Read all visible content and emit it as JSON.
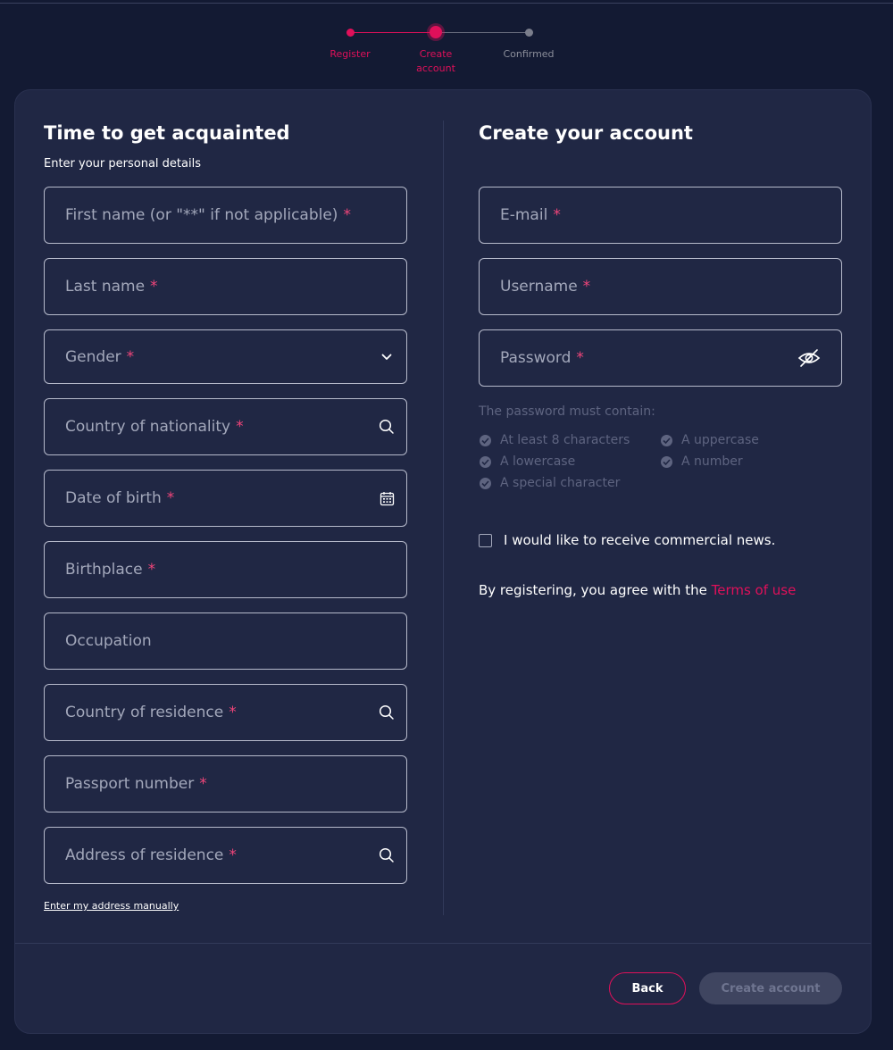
{
  "stepper": {
    "steps": [
      {
        "label": "Register",
        "state": "completed"
      },
      {
        "label": "Create account",
        "state": "current"
      },
      {
        "label": "Confirmed",
        "state": "upcoming"
      }
    ],
    "colors": {
      "active": "#e0105a",
      "inactive": "#7b7e8c"
    }
  },
  "personal": {
    "title": "Time to get acquainted",
    "subtitle": "Enter your personal details",
    "fields": {
      "first_name": "First name (or \"**\" if not applicable)",
      "last_name": "Last name",
      "gender": "Gender",
      "nationality": "Country of nationality",
      "dob": "Date of birth",
      "birthplace": "Birthplace",
      "occupation": "Occupation",
      "residence_country": "Country of residence",
      "passport": "Passport number",
      "address": "Address of residence"
    },
    "required_marker": "*",
    "manual_address_link": "Enter my address manually"
  },
  "account": {
    "title": "Create your account",
    "fields": {
      "email": "E-mail",
      "username": "Username",
      "password": "Password"
    },
    "password_rules_title": "The password must contain:",
    "password_rules": {
      "min_length": "At least 8 characters",
      "uppercase": "A uppercase",
      "lowercase": "A lowercase",
      "number": "A number",
      "special": "A special character"
    },
    "newsletter_label": "I would like to receive commercial news.",
    "newsletter_checked": false,
    "terms_text": "By registering, you agree with the",
    "terms_link": "Terms of use"
  },
  "actions": {
    "back": "Back",
    "create": "Create account",
    "create_enabled": false
  },
  "theme": {
    "background": "#131a33",
    "card": "#202744",
    "accent": "#e0105a"
  }
}
